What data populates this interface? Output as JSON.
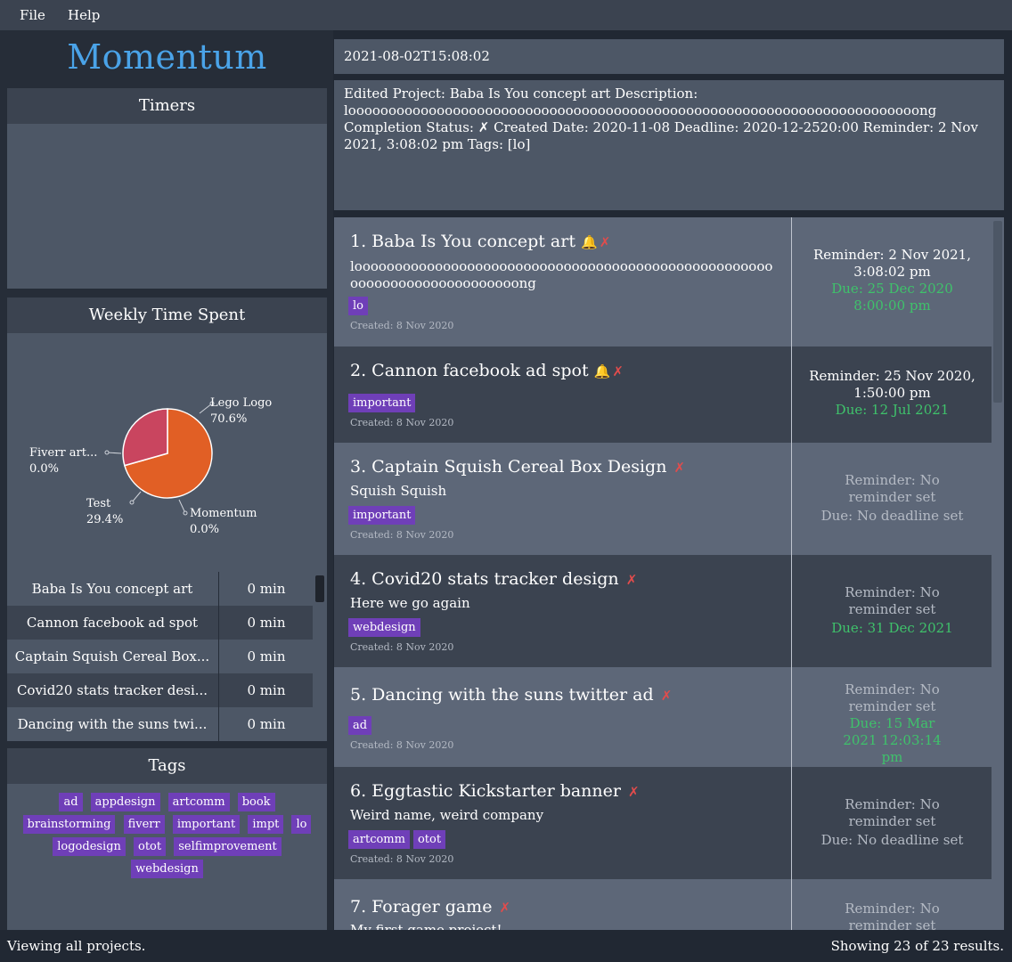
{
  "menu": {
    "file": "File",
    "help": "Help"
  },
  "app": {
    "title": "Momentum",
    "accent": "#4aa3e8"
  },
  "timers": {
    "heading": "Timers"
  },
  "weekly": {
    "heading": "Weekly Time Spent",
    "rows": [
      {
        "name": "Baba Is You concept art",
        "time": "0 min"
      },
      {
        "name": "Cannon facebook ad spot",
        "time": "0 min"
      },
      {
        "name": "Captain Squish Cereal Box...",
        "time": "0 min"
      },
      {
        "name": "Covid20 stats tracker desi...",
        "time": "0 min"
      },
      {
        "name": "Dancing with the suns twi...",
        "time": "0 min"
      }
    ]
  },
  "chart_data": {
    "type": "pie",
    "slices": [
      {
        "label": "Lego Logo",
        "value": 70.6,
        "display": "70.6%",
        "color": "#e15f25"
      },
      {
        "label": "Test",
        "value": 29.4,
        "display": "29.4%",
        "color": "#c9455f"
      },
      {
        "label": "Momentum",
        "value": 0.0,
        "display": "0.0%",
        "color": "#c98a2a"
      },
      {
        "label": "Fiverr art...",
        "value": 0.0,
        "display": "0.0%",
        "color": "#e3b04a"
      }
    ]
  },
  "tags_panel": {
    "heading": "Tags",
    "tags": [
      "ad",
      "appdesign",
      "artcomm",
      "book",
      "brainstorming",
      "fiverr",
      "important",
      "impt",
      "lo",
      "logodesign",
      "otot",
      "selfimprovement",
      "webdesign"
    ]
  },
  "command": {
    "value": "2021-08-02T15:08:02"
  },
  "result": {
    "text": "Edited Project: Baba Is You concept art Description: looooooooooooooooooooooooooooooooooooooooooooooooooooooooooooooooooooooong Completion Status: ✗ Created Date: 2020-11-08 Deadline: 2020-12-2520:00 Reminder: 2 Nov 2021, 3:08:02 pm Tags: [lo]"
  },
  "projects": [
    {
      "title": "1. Baba Is You concept art",
      "bell": "🔔",
      "cross": "✗",
      "desc": "looooooooooooooooooooooooooooooooooooooooooooooooooooooooooooooooooooooooong",
      "tags": [
        "lo"
      ],
      "created": "Created: 8 Nov 2020",
      "reminder": "Reminder: 2 Nov 2021, 3:08:02 pm",
      "due": "Due: 25 Dec 2020 8:00:00 pm"
    },
    {
      "title": "2. Cannon facebook ad spot",
      "bell": "🔔",
      "cross": "✗",
      "desc": "",
      "tags": [
        "important"
      ],
      "created": "Created: 8 Nov 2020",
      "reminder": "Reminder: 25 Nov 2020, 1:50:00 pm",
      "due": "Due: 12 Jul 2021"
    },
    {
      "title": "3. Captain Squish Cereal Box Design",
      "bell": "",
      "cross": "✗",
      "desc": "Squish Squish",
      "tags": [
        "important"
      ],
      "created": "Created: 8 Nov 2020",
      "reminder": "Reminder: No reminder set",
      "due": "Due: No deadline set"
    },
    {
      "title": "4. Covid20 stats tracker design",
      "bell": "",
      "cross": "✗",
      "desc": "Here we go again",
      "tags": [
        "webdesign"
      ],
      "created": "Created: 8 Nov 2020",
      "reminder": "Reminder: No reminder set",
      "due": "Due: 31 Dec 2021"
    },
    {
      "title": "5. Dancing with the suns twitter ad",
      "bell": "",
      "cross": "✗",
      "desc": "",
      "tags": [
        "ad"
      ],
      "created": "Created: 8 Nov 2020",
      "reminder": "Reminder: No reminder set",
      "due": "Due: 15 Mar 2021 12:03:14 pm"
    },
    {
      "title": "6. Eggtastic Kickstarter banner",
      "bell": "",
      "cross": "✗",
      "desc": "Weird name, weird company",
      "tags": [
        "artcomm",
        "otot"
      ],
      "created": "Created: 8 Nov 2020",
      "reminder": "Reminder: No reminder set",
      "due": "Due: No deadline set"
    },
    {
      "title": "7. Forager game",
      "bell": "",
      "cross": "✗",
      "desc": "My first game project!",
      "tags": [],
      "created": "",
      "reminder": "Reminder: No reminder set",
      "due": ""
    }
  ],
  "status": {
    "left": "Viewing all projects.",
    "right": "Showing 23 of 23 results."
  }
}
